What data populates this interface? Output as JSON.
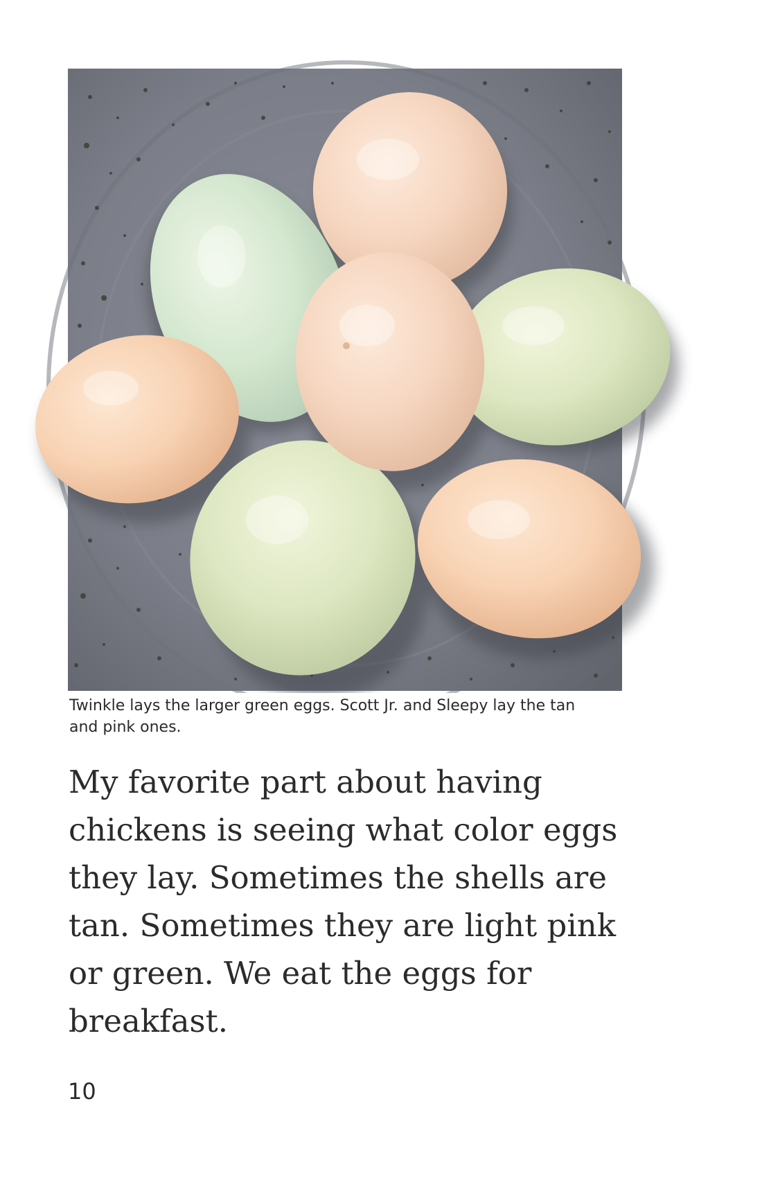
{
  "figure": {
    "image_icon": "eggs-in-speckled-bowl-photo",
    "colors": {
      "bowl": "#7c7f88",
      "bowl_speckle": "#3d4036",
      "egg_tan": "#f7cfae",
      "egg_green": "#dde7c4",
      "egg_blue_green": "#d4e7cf"
    },
    "caption": "Twinkle lays the larger green eggs. Scott Jr. and Sleepy lay the tan and pink ones."
  },
  "body": {
    "text": "My favorite part about having chickens is seeing what color eggs they lay. Sometimes the shells are tan. Sometimes they are light pink or green. We eat the eggs for breakfast."
  },
  "page": {
    "number": "10"
  }
}
